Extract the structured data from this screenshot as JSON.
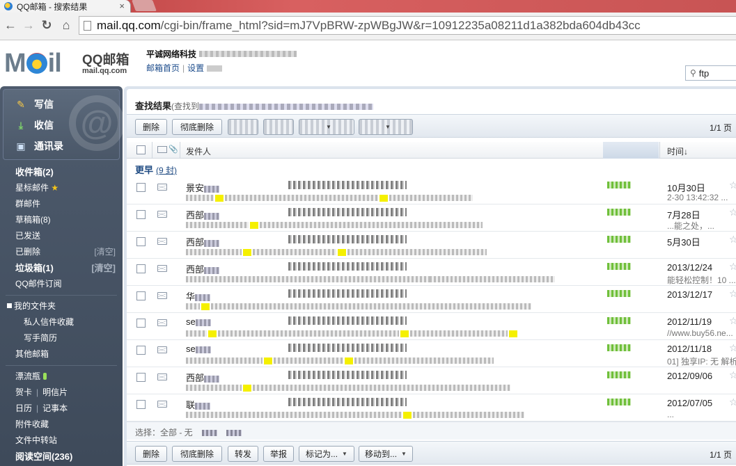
{
  "browser": {
    "tab_title": "QQ邮箱 - 搜索结果",
    "tab_close": "×",
    "url_host": "mail.qq.com",
    "url_path": "/cgi-bin/frame_html?sid=mJ7VpBRW-zpWBgJW&r=10912235a08211d1a382bda604db43cc"
  },
  "header": {
    "logo_main": "MOil",
    "logo_cn": "QQ邮箱",
    "logo_url": "mail.qq.com",
    "account_name": "平诚网络科技",
    "link_home": "邮箱首页",
    "link_settings": "设置",
    "search_value": "ftp"
  },
  "sidebar": {
    "compose": "写信",
    "receive": "收信",
    "contacts": "通讯录",
    "inbox": "收件箱(2)",
    "starred": "星标邮件",
    "group": "群邮件",
    "drafts": "草稿箱(8)",
    "sent": "已发送",
    "deleted": "已删除",
    "deleted_clear": "[清空]",
    "junk": "垃圾箱(1)",
    "junk_clear": "[清空]",
    "subscribe": "QQ邮件订阅",
    "my_folders": "我的文件夹",
    "folder_private": "私人信件收藏",
    "folder_resume": "写手简历",
    "other_mailbox": "其他邮箱",
    "bottle": "漂流瓶",
    "card": "贺卡",
    "postcard": "明信片",
    "calendar": "日历",
    "notes": "记事本",
    "attach_fav": "附件收藏",
    "file_transfer": "文件中转站",
    "reading": "阅读空间(236)"
  },
  "main": {
    "title": "查找结果",
    "title_sub": "(查找到",
    "btn_delete": "删除",
    "btn_perm_delete": "彻底删除",
    "btn_forward": "转发",
    "btn_report": "举报",
    "btn_mark": "标记为...",
    "btn_move": "移动到...",
    "pager": "1/1 页",
    "col_sender": "发件人",
    "col_time": "时间↓",
    "group_label": "更早",
    "group_count": "(9 封)",
    "select_label": "选择：全部 - 无"
  },
  "rows": [
    {
      "sender": "景安",
      "date": "10月30日",
      "tail": "2-30 13:42:32 ..."
    },
    {
      "sender": "西部",
      "date": "7月28日",
      "tail": "...能之处，..."
    },
    {
      "sender": "西部",
      "date": "5月30日",
      "tail": ""
    },
    {
      "sender": "西部",
      "date": "2013/12/24",
      "tail": "能轻松控制！10 ..."
    },
    {
      "sender": "华",
      "date": "2013/12/17",
      "tail": ""
    },
    {
      "sender": "se",
      "date": "2012/11/19",
      "tail": "//www.buy56.ne..."
    },
    {
      "sender": "se",
      "date": "2012/11/18",
      "tail": "01] 独享IP: 无 解析..."
    },
    {
      "sender": "西部",
      "date": "2012/09/06",
      "tail": ""
    },
    {
      "sender": "联",
      "date": "2012/07/05",
      "tail": "..."
    }
  ]
}
